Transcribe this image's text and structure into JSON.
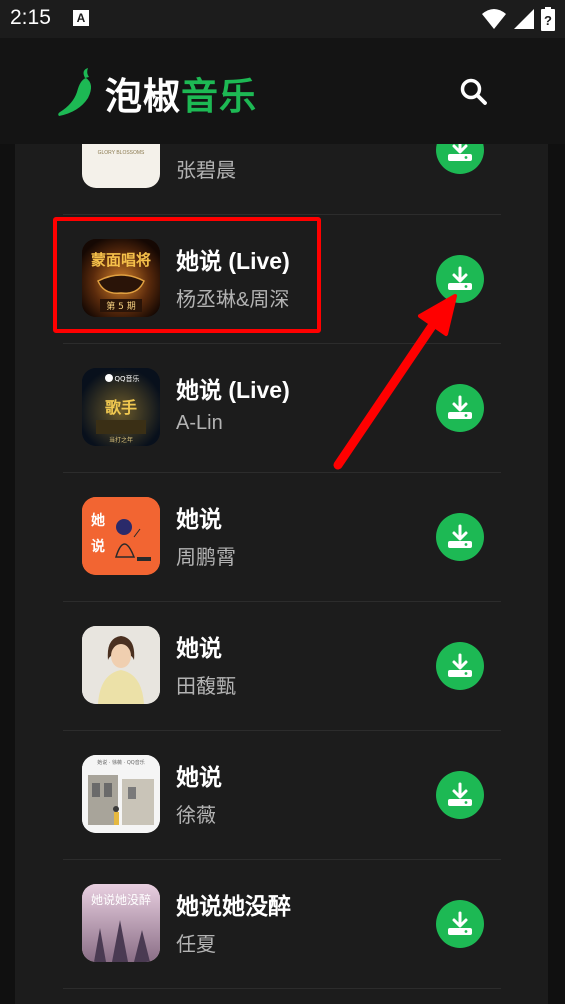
{
  "status_bar": {
    "time": "2:15",
    "notification_icon": "A"
  },
  "header": {
    "logo_part1": "泡椒",
    "logo_part2": "音乐",
    "colors": {
      "brand_green": "#1db954",
      "annotation_red": "#ff0000"
    }
  },
  "songs": [
    {
      "title": "",
      "artist": "张碧晨",
      "cover": "cover-1",
      "partial": true
    },
    {
      "title": "她说 (Live)",
      "artist": "杨丞琳&周深",
      "cover": "cover-2",
      "highlighted": true
    },
    {
      "title": "她说 (Live)",
      "artist": "A-Lin",
      "cover": "cover-3"
    },
    {
      "title": "她说",
      "artist": "周鹏霄",
      "cover": "cover-4"
    },
    {
      "title": "她说",
      "artist": "田馥甄",
      "cover": "cover-5"
    },
    {
      "title": "她说",
      "artist": "徐薇",
      "cover": "cover-6"
    },
    {
      "title": "她说她没醉",
      "artist": "任夏",
      "cover": "cover-7"
    }
  ]
}
